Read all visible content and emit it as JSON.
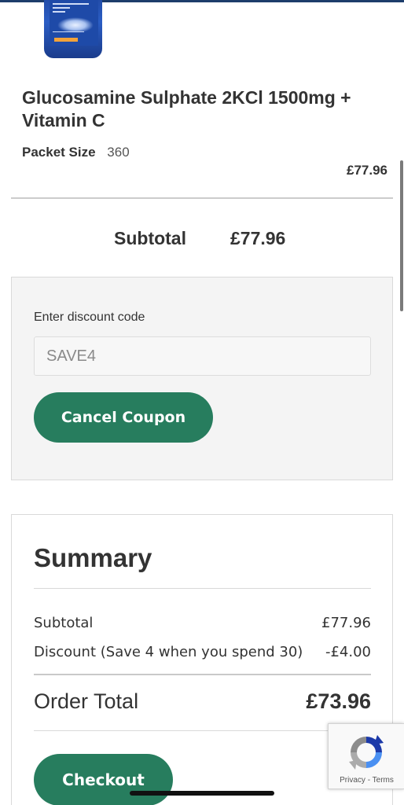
{
  "product": {
    "image_icon": "supplement-bottle-image",
    "name": "Glucosamine Sulphate 2KCl 1500mg + Vitamin C",
    "packet_size_label": "Packet Size",
    "packet_size_value": "360",
    "price": "£77.96"
  },
  "cart": {
    "subtotal_label": "Subtotal",
    "subtotal_value": "£77.96"
  },
  "discount": {
    "label": "Enter discount code",
    "code_value": "SAVE4",
    "cancel_button": "Cancel Coupon"
  },
  "summary": {
    "title": "Summary",
    "rows": [
      {
        "label": "Subtotal",
        "value": "£77.96"
      },
      {
        "label": "Discount (Save 4 when you spend 30)",
        "value": "-£4.00"
      }
    ],
    "order_total_label": "Order Total",
    "order_total_value": "£73.96",
    "checkout_button": "Checkout"
  },
  "recaptcha": {
    "icon": "recaptcha-icon",
    "privacy": "Privacy",
    "separator": "-",
    "terms": "Terms"
  },
  "colors": {
    "brand_green": "#277d5e",
    "top_strip": "#1d3d6b",
    "text": "#333333"
  }
}
